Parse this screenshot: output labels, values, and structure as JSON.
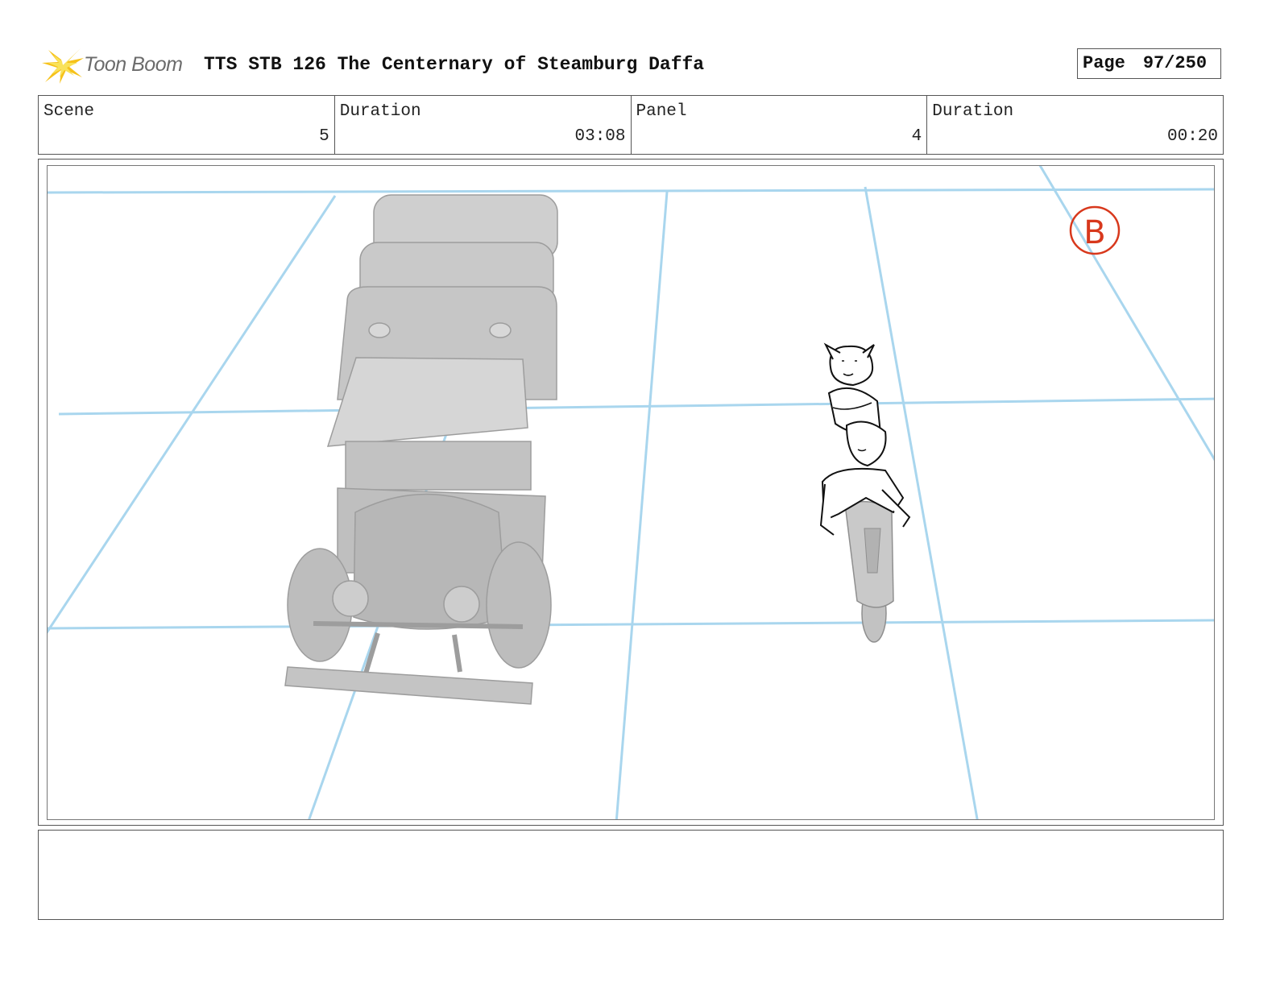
{
  "header": {
    "logo_text": "Toon Boom",
    "title": "TTS STB 126 The Centernary of Steamburg Daffa",
    "page_label": "Page",
    "page_value": "97/250"
  },
  "info": {
    "scene_label": "Scene",
    "scene_value": "5",
    "scene_duration_label": "Duration",
    "scene_duration_value": "03:08",
    "panel_label": "Panel",
    "panel_value": "4",
    "panel_duration_label": "Duration",
    "panel_duration_value": "00:20"
  },
  "panel": {
    "marker": "B",
    "guide_color": "#a9d6ee",
    "marker_color": "#d8381c"
  },
  "notes": {
    "text": ""
  }
}
